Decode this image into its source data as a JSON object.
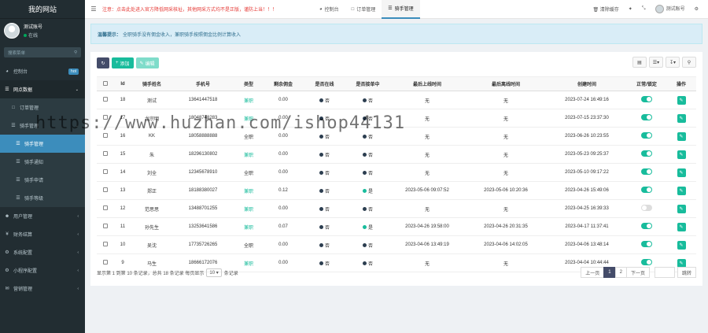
{
  "sidebar": {
    "brand": "我的网站",
    "user_name": "测试账号",
    "status": "在线",
    "search_placeholder": "搜索菜单",
    "items": [
      {
        "label": "控制台",
        "badge": "hot"
      },
      {
        "label": "网点数据"
      },
      {
        "label": "订单管理"
      },
      {
        "label": "骑手管理"
      },
      {
        "label": "骑手管理"
      },
      {
        "label": "骑手通知"
      },
      {
        "label": "骑手申请"
      },
      {
        "label": "骑手等级"
      },
      {
        "label": "用户管理"
      },
      {
        "label": "财务结算"
      },
      {
        "label": "系统配置"
      },
      {
        "label": "小程序配置"
      },
      {
        "label": "营销管理"
      }
    ]
  },
  "topbar": {
    "notice": "注意：点击此处进入官方降低网采核址，其他网采方式均不是正版，谨防上当！！！",
    "tabs": [
      {
        "label": "控制台"
      },
      {
        "label": "订单管理"
      },
      {
        "label": "骑手管理"
      }
    ],
    "clear_cache": "清除缓存",
    "user": "测试账号"
  },
  "tip": {
    "label": "温馨提示：",
    "text": "全职骑手没有佣金收入，兼职骑手按照佣金比例计算收入"
  },
  "toolbar": {
    "add": "添加",
    "edit": "编辑"
  },
  "table": {
    "headers": [
      "Id",
      "骑手姓名",
      "手机号",
      "类型",
      "剩余佣金",
      "是否在线",
      "是否接单中",
      "最后上线时间",
      "最后离线时间",
      "创建时间",
      "正常/锁定",
      "操作"
    ],
    "rows": [
      {
        "id": "18",
        "name": "测试",
        "phone": "13641447518",
        "type": "兼职",
        "balance": "0.00",
        "online": "否",
        "taking": "否",
        "last_on": "无",
        "last_off": "无",
        "created": "2023-07-24 16:49:16",
        "enabled": true
      },
      {
        "id": "17",
        "name": "龙宗明",
        "phone": "18048748283",
        "type": "兼职",
        "balance": "0.00",
        "online": "否",
        "taking": "否",
        "last_on": "无",
        "last_off": "无",
        "created": "2023-07-15 23:37:30",
        "enabled": true
      },
      {
        "id": "16",
        "name": "KK",
        "phone": "18058888888",
        "type": "全职",
        "balance": "0.00",
        "online": "否",
        "taking": "否",
        "last_on": "无",
        "last_off": "无",
        "created": "2023-06-26 10:23:55",
        "enabled": true
      },
      {
        "id": "15",
        "name": "朱",
        "phone": "18296130802",
        "type": "兼职",
        "balance": "0.00",
        "online": "否",
        "taking": "否",
        "last_on": "无",
        "last_off": "无",
        "created": "2023-05-23 09:25:37",
        "enabled": true
      },
      {
        "id": "14",
        "name": "刘全",
        "phone": "12345678910",
        "type": "全职",
        "balance": "0.00",
        "online": "否",
        "taking": "否",
        "last_on": "无",
        "last_off": "无",
        "created": "2023-05-10 09:17:22",
        "enabled": true
      },
      {
        "id": "13",
        "name": "郑正",
        "phone": "18188380027",
        "type": "兼职",
        "balance": "0.12",
        "online": "否",
        "taking": "是",
        "last_on": "2023-05-06 09:07:52",
        "last_off": "2023-05-06 10:20:36",
        "created": "2023-04-26 15:49:06",
        "enabled": true
      },
      {
        "id": "12",
        "name": "范思思",
        "phone": "13488701255",
        "type": "兼职",
        "balance": "0.00",
        "online": "否",
        "taking": "否",
        "last_on": "无",
        "last_off": "无",
        "created": "2023-04-25 16:39:33",
        "enabled": false
      },
      {
        "id": "11",
        "name": "孙先生",
        "phone": "13253641586",
        "type": "兼职",
        "balance": "0.07",
        "online": "否",
        "taking": "是",
        "last_on": "2023-04-26 19:58:00",
        "last_off": "2023-04-26 20:31:35",
        "created": "2023-04-17 11:37:41",
        "enabled": true
      },
      {
        "id": "10",
        "name": "吴沈",
        "phone": "17735726265",
        "type": "全职",
        "balance": "0.00",
        "online": "否",
        "taking": "否",
        "last_on": "2023-04-06 13:49:19",
        "last_off": "2023-04-06 14:02:05",
        "created": "2023-04-06 13:48:14",
        "enabled": true
      },
      {
        "id": "9",
        "name": "马生",
        "phone": "18666172076",
        "type": "兼职",
        "balance": "0.00",
        "online": "否",
        "taking": "否",
        "last_on": "无",
        "last_off": "无",
        "created": "2023-04-04 10:44:44",
        "enabled": true
      }
    ]
  },
  "footer": {
    "summary_pre": "显示第 1 到第 10 条记录，总共 18 条记录 每页显示",
    "page_size": "10",
    "summary_post": "条记录",
    "prev": "上一页",
    "pages": [
      "1",
      "2"
    ],
    "next": "下一页",
    "go": "跳转"
  },
  "watermark": "https://www.huzhan.com/ishop44131",
  "colors": {
    "accent": "#18bc9c",
    "sidebar": "#222d32",
    "active": "#3c8dbc"
  }
}
